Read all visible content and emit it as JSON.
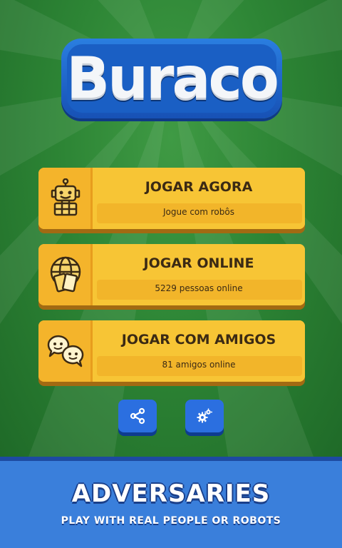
{
  "logo": {
    "text": "Buraco"
  },
  "menu": [
    {
      "title": "JOGAR AGORA",
      "subtitle": "Jogue com robôs",
      "icon": "robot-icon"
    },
    {
      "title": "JOGAR ONLINE",
      "subtitle": "5229 pessoas online",
      "icon": "globe-cards-icon"
    },
    {
      "title": "JOGAR COM AMIGOS",
      "subtitle": "81 amigos online",
      "icon": "friends-chat-icon"
    }
  ],
  "bottom_buttons": [
    {
      "icon": "share-icon"
    },
    {
      "icon": "settings-icon"
    }
  ],
  "banner": {
    "title": "ADVERSARIES",
    "subtitle": "PLAY WITH REAL PEOPLE OR ROBOTS"
  },
  "colors": {
    "felt": "#2d8535",
    "button": "#f7c535",
    "blue": "#2b6fe0",
    "banner": "#3a7fdb"
  }
}
